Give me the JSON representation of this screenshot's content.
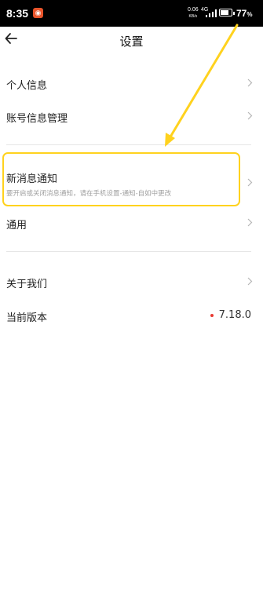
{
  "status_bar": {
    "time": "8:35",
    "speed_value": "0.06",
    "speed_unit": "KB/s",
    "network": "4G",
    "battery_percent": "77",
    "battery_level": 0.77
  },
  "header": {
    "title": "设置"
  },
  "menu": {
    "personal_info": "个人信息",
    "account_management": "账号信息管理",
    "notifications": {
      "title": "新消息通知",
      "description": "要开启或关闭消息通知，请在手机设置-通知-自如中更改"
    },
    "general": "通用",
    "about_us": "关于我们",
    "current_version": {
      "label": "当前版本",
      "value": "7.18.0"
    }
  },
  "annotation": {
    "color": "#ffd21e"
  }
}
